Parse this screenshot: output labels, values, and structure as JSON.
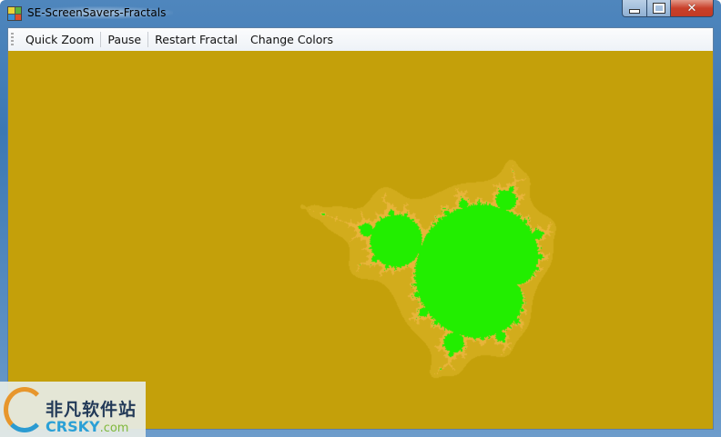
{
  "window": {
    "title": "SE-ScreenSavers-Fractals",
    "minimize": "minimize",
    "maximize": "maximize",
    "close_label": "✕"
  },
  "toolbar": {
    "items": [
      {
        "label": "Quick Zoom"
      },
      {
        "label": "Pause"
      },
      {
        "label": "Restart Fractal"
      },
      {
        "label": "Change Colors"
      }
    ]
  },
  "fractal": {
    "colors": {
      "background": "#c4a00a",
      "set": "#22ee00",
      "halo": "#d2ac1c",
      "edge": "#e8b43a"
    }
  },
  "watermark": {
    "chinese": "非凡软件站",
    "brand": "CRSKY",
    "domain": ".com"
  }
}
